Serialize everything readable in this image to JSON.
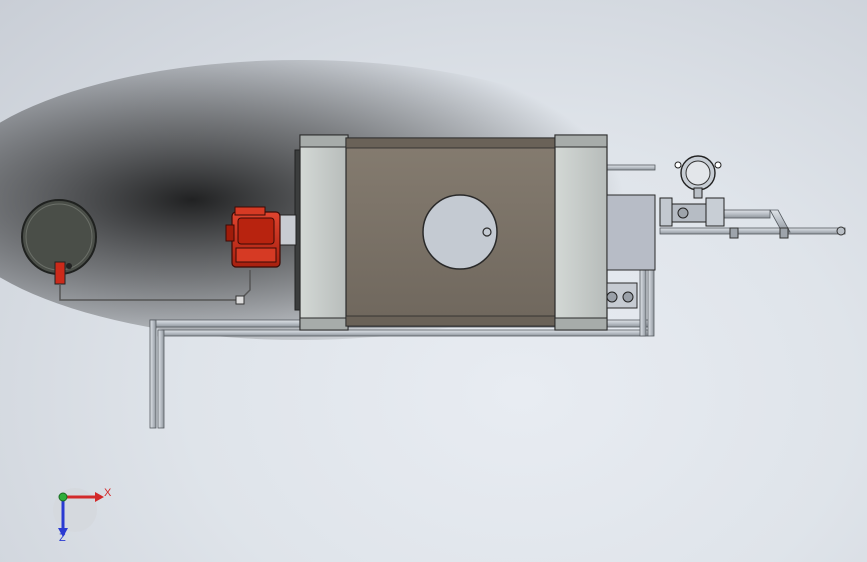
{
  "viewport": {
    "background_top": "#c9ced6",
    "background_bottom": "#e6eaf0",
    "shadow_color": "#1a1a1a"
  },
  "model": {
    "body_color": "#7a7268",
    "end_plate_color": "#c7ccc9",
    "edge_color": "#2a2a2a",
    "burner_color": "#cc2a1a",
    "tank_color": "#4a4e48",
    "pipe_color": "#b9bfc6",
    "icons": [
      "tank-icon",
      "burner-icon",
      "pressure-gauge-icon",
      "valve-icon"
    ]
  },
  "triad": {
    "x_label": "X",
    "z_label": "Z",
    "x_color": "#d22a2a",
    "y_color": "#2fae3a",
    "z_color": "#2a3ad2"
  }
}
